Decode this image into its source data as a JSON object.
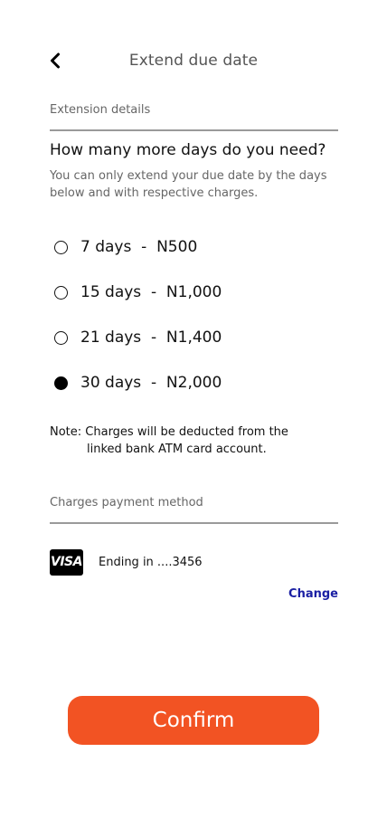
{
  "header": {
    "back_icon": "chevron-left-icon",
    "title": "Extend due date"
  },
  "extension": {
    "section_label": "Extension details",
    "question": "How many more days do you need?",
    "subtext": "You can only extend your due date by the days below and with respective charges.",
    "options": [
      {
        "label": "7 days  -  N500",
        "selected": false
      },
      {
        "label": "15 days  -  N1,000",
        "selected": false
      },
      {
        "label": "21 days  -  N1,400",
        "selected": false
      },
      {
        "label": "30 days  -  N2,000",
        "selected": true
      }
    ]
  },
  "note": {
    "line1": "Note: Charges will be deducted from the",
    "line2": "linked bank ATM card account."
  },
  "payment": {
    "section_label": "Charges payment method",
    "card_brand": "VISA",
    "card_text": "Ending in ....3456",
    "change_label": "Change"
  },
  "confirm": {
    "label": "Confirm"
  },
  "colors": {
    "accent": "#f25323",
    "link": "#1a1fa3"
  }
}
